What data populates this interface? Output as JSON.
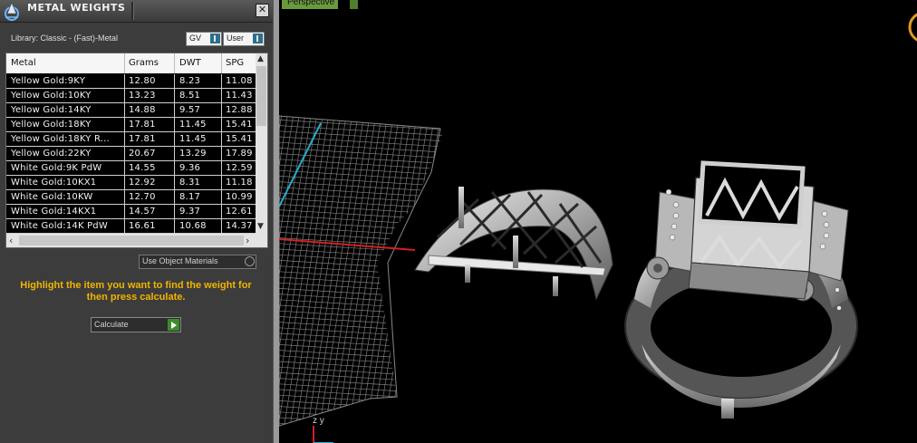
{
  "panel": {
    "title": "METAL WEIGHTS",
    "close_glyph": "✕",
    "library_label": "Library: Classic - (Fast)-Metal",
    "gv_label": "GV",
    "user_label": "User",
    "table": {
      "columns": [
        "Metal",
        "Grams",
        "DWT",
        "SPG"
      ],
      "rows": [
        [
          "Yellow Gold:9KY",
          "12.80",
          "8.23",
          "11.08"
        ],
        [
          "Yellow Gold:10KY",
          "13.23",
          "8.51",
          "11.43"
        ],
        [
          "Yellow Gold:14KY",
          "14.88",
          "9.57",
          "12.88"
        ],
        [
          "Yellow Gold:18KY",
          "17.81",
          "11.45",
          "15.41"
        ],
        [
          "Yellow Gold:18KY R...",
          "17.81",
          "11.45",
          "15.41"
        ],
        [
          "Yellow Gold:22KY",
          "20.67",
          "13.29",
          "17.89"
        ],
        [
          "White Gold:9K PdW",
          "14.55",
          "9.36",
          "12.59"
        ],
        [
          "White Gold:10KX1",
          "12.92",
          "8.31",
          "11.18"
        ],
        [
          "White Gold:10KW",
          "12.70",
          "8.17",
          "10.99"
        ],
        [
          "White Gold:14KX1",
          "14.57",
          "9.37",
          "12.61"
        ],
        [
          "White Gold:14K PdW",
          "16.61",
          "10.68",
          "14.37"
        ]
      ]
    },
    "use_object_materials": "Use Object Materials",
    "hint": "Highlight the item you want to find the weight for then press calculate.",
    "calculate_label": "Calculate"
  },
  "viewport": {
    "label": "Perspective",
    "axis_label": "z y"
  },
  "colors": {
    "panel_bg": "#3c3c3c",
    "hint_text": "#f0b400",
    "view_label_bg": "#6a9a3a",
    "grid_line": "#7a7a7a",
    "x_axis": "#d22020",
    "y_axis": "#2aa8c8"
  },
  "icons": {
    "title_logo": "matrix-logo-icon",
    "vertical_scroll_up": "arrow-up-icon",
    "vertical_scroll_down": "arrow-down-icon",
    "horizontal_scroll_left": "arrow-left-icon",
    "horizontal_scroll_right": "arrow-right-icon",
    "calculate_play": "play-icon"
  }
}
